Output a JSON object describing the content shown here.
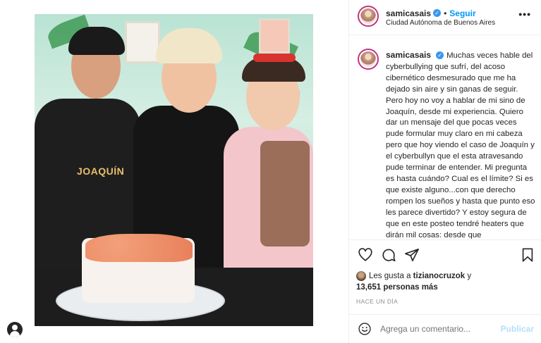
{
  "post": {
    "username": "samicasais",
    "follow_label": "Seguir",
    "location": "Ciudad Autónoma de Buenos Aires",
    "separator": "•",
    "more_label": "•••",
    "photo_apron_text": "JOAQUÍN",
    "caption": "Muchas veces hable del cyberbullying que sufrí, del acoso cibernético desmesurado que me ha dejado sin aire y sin ganas de seguir. Pero hoy no voy a hablar de mi sino de Joaquín, desde mi experiencia. Quiero dar un mensaje del que pocas veces pude formular muy claro en mi cabeza pero que hoy viendo el caso de Joaquín y el cyberbullyn que el esta atravesando pude terminar de entender. Mi pregunta es hasta cuándo? Cual es el límite? Si es que existe alguno...con que derecho rompen los sueños y hasta que punto eso les parece divertido? Y estoy segura de que en este posteo tendré heaters que dirán mil cosas: desde que",
    "likes_prefix": "Les gusta a",
    "likes_user": "tizianocruzok",
    "likes_connector": "y",
    "likes_count": "13,651 personas más",
    "time_ago": "HACE UN DÍA",
    "comment_placeholder": "Agrega un comentario...",
    "publish_label": "Publicar"
  },
  "icons": {
    "heart": "heart-icon",
    "comment": "comment-icon",
    "share": "share-icon",
    "save": "bookmark-icon",
    "more": "more-options-icon",
    "emoji": "emoji-icon",
    "verified": "verified-badge-icon"
  },
  "colors": {
    "link_blue": "#0095f6",
    "verified_blue": "#3897f0",
    "publish_disabled": "#b2dffc",
    "text": "#262626",
    "muted": "#8e8e8e"
  }
}
